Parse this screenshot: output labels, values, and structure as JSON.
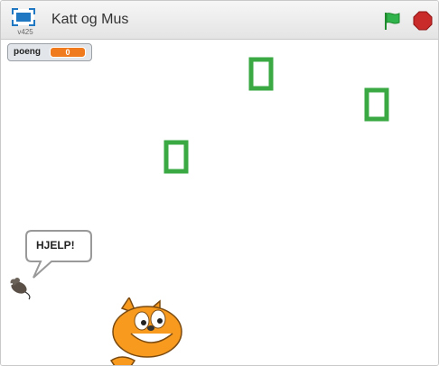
{
  "project": {
    "title": "Katt og Mus",
    "version": "v425"
  },
  "monitor": {
    "label": "poeng",
    "value": "0"
  },
  "speech": {
    "text": "HJELP!"
  },
  "colors": {
    "flag": "#2fb34a",
    "stop": "#c92a2a",
    "monitor_value": "#f07a1e",
    "cheese": "#3aa843",
    "cat": "#f79a1e"
  },
  "icons": {
    "fullscreen": "fullscreen-icon",
    "flag": "green-flag-icon",
    "stop": "stop-icon"
  }
}
